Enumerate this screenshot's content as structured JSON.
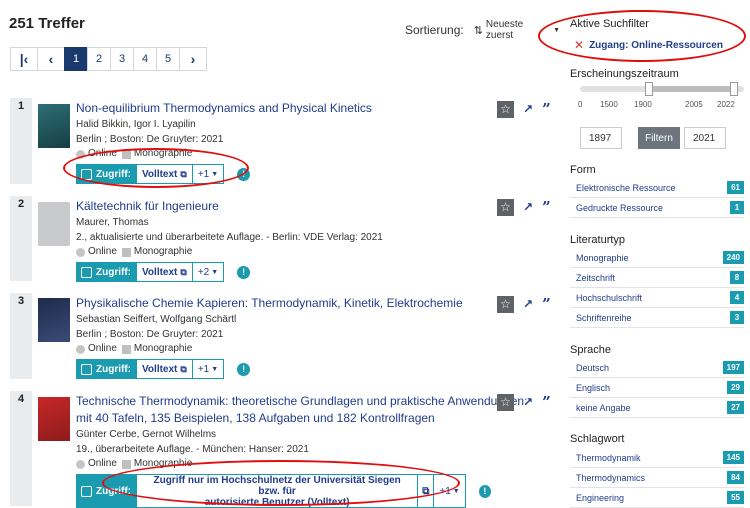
{
  "header": {
    "count": "251 Treffer",
    "sort_label": "Sortierung:",
    "sort_value": "Neueste zuerst"
  },
  "pager": {
    "first": "|<",
    "prev": "<",
    "pages": [
      "1",
      "2",
      "3",
      "4",
      "5"
    ],
    "next": ">",
    "current": "1"
  },
  "results": [
    {
      "num": "1",
      "title": "Non-equilibrium Thermodynamics and Physical Kinetics",
      "authors": "Halid Bikkin, Igor I. Lyapilin",
      "pub": "Berlin ; Boston: De Gruyter: 2021",
      "online": "Online",
      "type": "Monographie",
      "access_label": "Zugriff:",
      "access_link": "Volltext",
      "more": "+1"
    },
    {
      "num": "2",
      "title": "Kältetechnik für Ingenieure",
      "authors": "Maurer, Thomas",
      "pub": "2., aktualisierte und überarbeitete Auflage. - Berlin: VDE Verlag: 2021",
      "online": "Online",
      "type": "Monographie",
      "access_label": "Zugriff:",
      "access_link": "Volltext",
      "more": "+2"
    },
    {
      "num": "3",
      "title": "Physikalische Chemie Kapieren: Thermodynamik, Kinetik, Elektrochemie",
      "authors": "Sebastian Seiffert, Wolfgang Schärtl",
      "pub": "Berlin ; Boston: De Gruyter: 2021",
      "online": "Online",
      "type": "Monographie",
      "access_label": "Zugriff:",
      "access_link": "Volltext",
      "more": "+1"
    },
    {
      "num": "4",
      "title_line1": "Technische Thermodynamik: theoretische Grundlagen und praktische Anwendungen:",
      "title_line2": "mit 40 Tafeln, 135 Beispielen, 138 Aufgaben und 182 Kontrollfragen",
      "authors": "Günter Cerbe, Gernot Wilhelms",
      "pub": "19., überarbeitete Auflage. - München: Hanser: 2021",
      "online": "Online",
      "type": "Monographie",
      "access_label": "Zugriff:",
      "access_link_line1": "Zugriff nur im Hochschulnetz der Universität Siegen bzw. für",
      "access_link_line2": "autorisierte Benutzer (Volltext)",
      "more": "+1"
    }
  ],
  "sidebar": {
    "active_head": "Aktive Suchfilter",
    "active_filter": "Zugang: Online-Ressourcen",
    "period_head": "Erscheinungszeitraum",
    "ticks": [
      "0",
      "1500",
      "1900",
      "2005",
      "2022"
    ],
    "year_from": "1897",
    "year_to": "2021",
    "filter_btn": "Filtern",
    "form_head": "Form",
    "form": [
      {
        "label": "Elektronische Ressource",
        "count": "61"
      },
      {
        "label": "Gedruckte Ressource",
        "count": "1"
      }
    ],
    "lit_head": "Literaturtyp",
    "lit": [
      {
        "label": "Monographie",
        "count": "240"
      },
      {
        "label": "Zeitschrift",
        "count": "8"
      },
      {
        "label": "Hochschulschrift",
        "count": "4"
      },
      {
        "label": "Schriftenreihe",
        "count": "3"
      }
    ],
    "lang_head": "Sprache",
    "lang": [
      {
        "label": "Deutsch",
        "count": "197"
      },
      {
        "label": "Englisch",
        "count": "29"
      },
      {
        "label": "keine Angabe",
        "count": "27"
      }
    ],
    "subj_head": "Schlagwort",
    "subj": [
      {
        "label": "Thermodynamik",
        "count": "145"
      },
      {
        "label": "Thermodynamics",
        "count": "84"
      },
      {
        "label": "Engineering",
        "count": "55"
      }
    ]
  },
  "colors": {
    "accent": "#1b9bb0",
    "link": "#1f3d8a",
    "annotation": "#e10e0e"
  }
}
